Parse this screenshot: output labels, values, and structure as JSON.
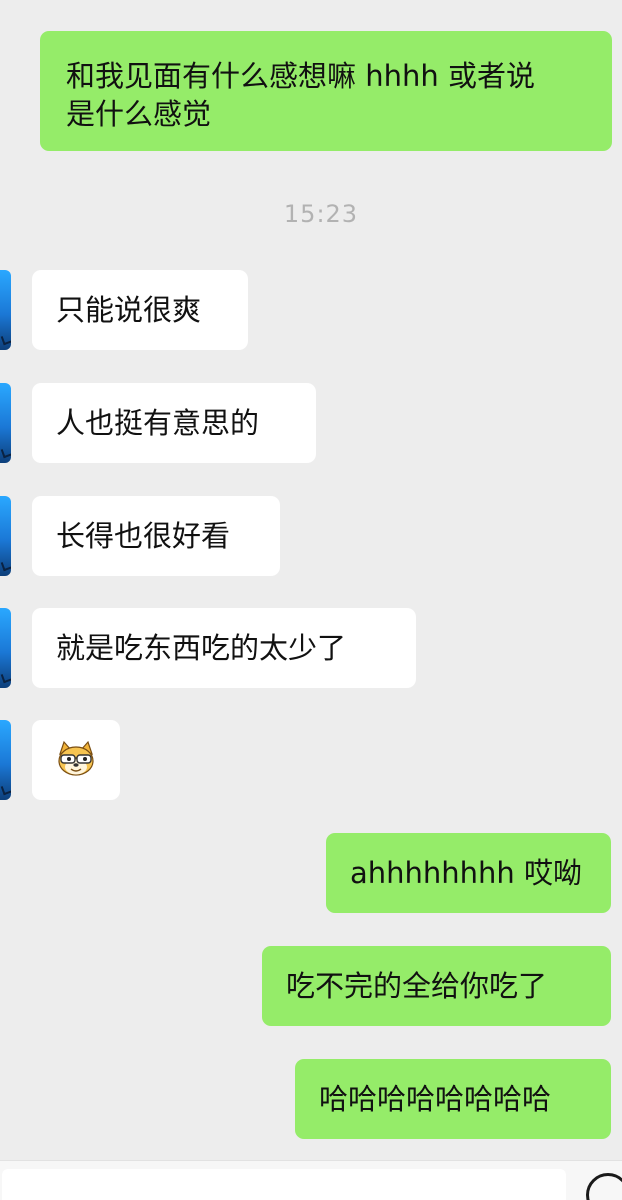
{
  "chat": {
    "messages": [
      {
        "side": "out",
        "text": "和我见面有什么感想嘛 hhhh 或者说",
        "text2": "是什么感觉"
      },
      {
        "side": "time",
        "text": "15:23"
      },
      {
        "side": "in",
        "text": "只能说很爽"
      },
      {
        "side": "in",
        "text": "人也挺有意思的"
      },
      {
        "side": "in",
        "text": "长得也很好看"
      },
      {
        "side": "in",
        "text": "就是吃东西吃的太少了"
      },
      {
        "side": "in",
        "sticker": "doge-sunglasses-emoji"
      },
      {
        "side": "out",
        "text": "ahhhhhhhh 哎呦"
      },
      {
        "side": "out",
        "text": "吃不完的全给你吃了"
      },
      {
        "side": "out",
        "text": "哈哈哈哈哈哈哈哈"
      }
    ]
  },
  "colors": {
    "background": "#ededed",
    "outgoing_bubble": "#95ec69",
    "incoming_bubble": "#ffffff",
    "timestamp": "#b2b2b2"
  },
  "icons": {
    "avatar": "avatar-icon",
    "sticker": "doge-emoji-icon",
    "input_action": "circle-button-icon"
  }
}
